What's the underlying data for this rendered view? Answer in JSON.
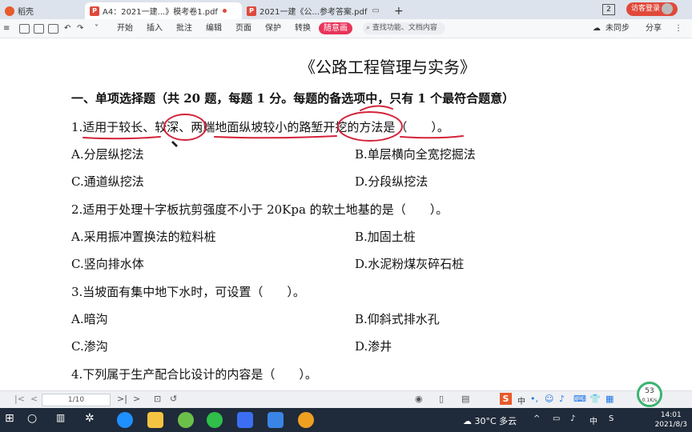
{
  "tabs": {
    "home_label": "稻壳",
    "tab1_label": "A4：2021一建...》模考卷1.pdf",
    "tab1_icon_text": "P",
    "tab2_label": "2021一建《公...参考答案.pdf",
    "tab2_icon_text": "P",
    "new_tab_symbol": "+",
    "window_count": "2",
    "visitor_login": "访客登录"
  },
  "toolbar": {
    "menus": [
      "开始",
      "插入",
      "批注",
      "编辑",
      "页面",
      "保护",
      "转换"
    ],
    "suiyi_label": "随意画",
    "search_placeholder": "查找功能、文档内容",
    "sync_label": "未同步",
    "share_label": "分享"
  },
  "document": {
    "title": "《公路工程管理与实务》",
    "section_heading": "一、单项选择题（共 20 题，每题 1 分。每题的备选项中，只有 1 个最符合题意）",
    "questions": [
      {
        "stem": "1.适用于较长、较深、两端地面纵坡较小的路堑开挖的方法是（　　）。",
        "options": [
          "A.分层纵挖法",
          "B.单层横向全宽挖掘法",
          "C.通道纵挖法",
          "D.分段纵挖法"
        ]
      },
      {
        "stem": "2.适用于处理十字板抗剪强度不小于 20Kpa 的软土地基的是（　　）。",
        "options": [
          "A.采用振冲置换法的粒料桩",
          "B.加固土桩",
          "C.竖向排水体",
          "D.水泥粉煤灰碎石桩"
        ]
      },
      {
        "stem": "3.当坡面有集中地下水时，可设置（　　）。",
        "options": [
          "A.暗沟",
          "B.仰斜式排水孔",
          "C.渗沟",
          "D.渗井"
        ]
      },
      {
        "stem": "4.下列属于生产配合比设计的内容是（　　）。",
        "options": []
      }
    ]
  },
  "bottombar": {
    "page_indicator": "1/10",
    "progress_percent": "53",
    "progress_sub": "0.1K/s",
    "ime_label": "中"
  },
  "taskbar": {
    "weather_text": "30°C 多云",
    "time": "14:01",
    "date": "2021/8/3"
  },
  "colors": {
    "tab_bg": "#dde3ec",
    "accent_red": "#e0493b",
    "suiyi_pink": "#e8345a",
    "annotation_red": "#d4233a",
    "taskbar_bg": "#1f2a3a"
  }
}
